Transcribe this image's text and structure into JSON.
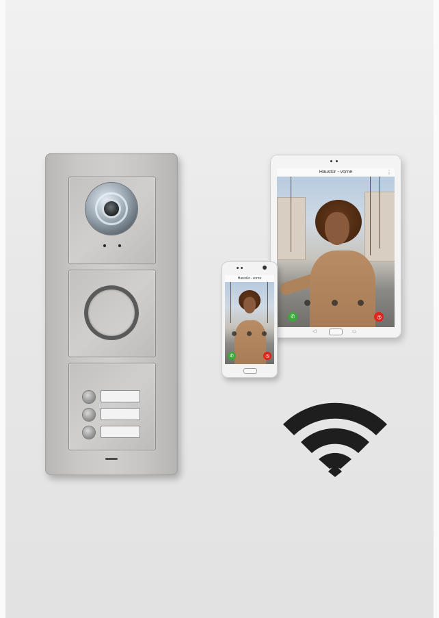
{
  "tablet": {
    "screen_title": "Haustür - vorne",
    "menu_glyph": "⋮",
    "accept_glyph": "✆",
    "decline_glyph": "✆",
    "nav_back": "◁",
    "nav_recent": "▭"
  },
  "phone": {
    "status_text": "Haustür - vorne",
    "screen_title": "Haustür - vorne",
    "accept_glyph": "✆",
    "decline_glyph": "✆"
  },
  "colors": {
    "accept": "#3aa83a",
    "decline": "#e0241b",
    "wifi": "#1e1e1e"
  },
  "icons": [
    "door-station-camera",
    "door-station-button",
    "bell-button",
    "accept-call-icon",
    "decline-call-icon",
    "wifi-icon"
  ]
}
